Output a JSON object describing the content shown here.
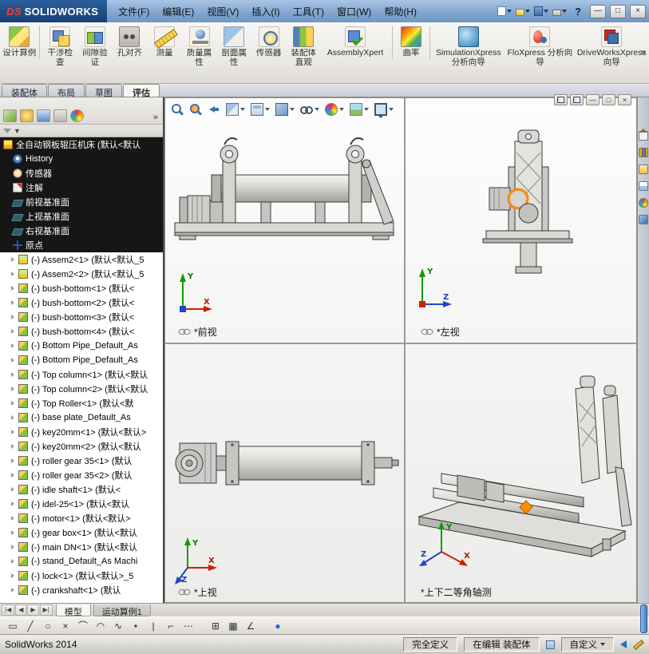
{
  "window": {
    "logo_ds": "DS",
    "logo_name": "SOLIDWORKS",
    "help_glyph": "?",
    "minimize_glyph": "—",
    "maximize_glyph": "□",
    "close_glyph": "×"
  },
  "menus": [
    {
      "label": "文件(F)"
    },
    {
      "label": "编辑(E)"
    },
    {
      "label": "视图(V)"
    },
    {
      "label": "插入(I)"
    },
    {
      "label": "工具(T)"
    },
    {
      "label": "窗口(W)"
    },
    {
      "label": "帮助(H)"
    }
  ],
  "ribbon": {
    "overflow_glyph": "»",
    "items": [
      {
        "label": "设计算例",
        "icon": "ic-study",
        "cls": "big sep-right"
      },
      {
        "label": "干涉检查",
        "icon": "ic-interference",
        "cls": ""
      },
      {
        "label": "间隙验证",
        "icon": "ic-clearance",
        "cls": ""
      },
      {
        "label": "孔对齐",
        "icon": "ic-hole",
        "cls": ""
      },
      {
        "label": "测量",
        "icon": "ic-measure",
        "cls": ""
      },
      {
        "label": "质量属性",
        "icon": "ic-mass",
        "cls": ""
      },
      {
        "label": "剖面属性",
        "icon": "ic-sectionprop",
        "cls": ""
      },
      {
        "label": "传感器",
        "icon": "ic-sensor",
        "cls": ""
      },
      {
        "label": "装配体直观",
        "icon": "ic-visualize",
        "cls": ""
      },
      {
        "label": "AssemblyXpert",
        "icon": "ic-xpert",
        "cls": "wide sep-right"
      },
      {
        "label": "曲率",
        "icon": "ic-curvature",
        "cls": "sep-right"
      },
      {
        "label": "SimulationXpress 分析向导",
        "icon": "ic-simulation",
        "cls": "wide"
      },
      {
        "label": "FloXpress 分析向导",
        "icon": "ic-floxpress",
        "cls": "wide"
      },
      {
        "label": "DriveWorksXpress 向导",
        "icon": "ic-driveworks",
        "cls": "wide"
      }
    ]
  },
  "doc_tabs": [
    {
      "label": "装配体",
      "cls": ""
    },
    {
      "label": "布局",
      "cls": ""
    },
    {
      "label": "草图",
      "cls": ""
    },
    {
      "label": "评估",
      "cls": "active"
    }
  ],
  "tree": {
    "filter_glyph": "▼",
    "more_glyph": "»",
    "items": [
      {
        "label": "全自动钢板辊压机床 (默认<默认",
        "icon": "t-assembly",
        "cls": "dark root"
      },
      {
        "label": "History",
        "icon": "t-history",
        "cls": "dark"
      },
      {
        "label": "传感器",
        "icon": "t-sensor",
        "cls": "dark"
      },
      {
        "label": "注解",
        "icon": "t-annotation",
        "cls": "dark"
      },
      {
        "label": "前视基准面",
        "icon": "t-plane",
        "cls": "dark"
      },
      {
        "label": "上视基准面",
        "icon": "t-plane",
        "cls": "dark"
      },
      {
        "label": "右视基准面",
        "icon": "t-plane",
        "cls": "dark"
      },
      {
        "label": "原点",
        "icon": "t-origin",
        "cls": "dark"
      },
      {
        "label": "(-) Assem2<1> (默认<默认_5",
        "icon": "t-subasm",
        "cls": "comp"
      },
      {
        "label": "(-) Assem2<2> (默认<默认_5",
        "icon": "t-subasm",
        "cls": "comp"
      },
      {
        "label": "(-) bush-bottom<1> (默认<",
        "icon": "t-part",
        "cls": "comp"
      },
      {
        "label": "(-) bush-bottom<2> (默认<",
        "icon": "t-part",
        "cls": "comp"
      },
      {
        "label": "(-) bush-bottom<3> (默认<",
        "icon": "t-part",
        "cls": "comp"
      },
      {
        "label": "(-) bush-bottom<4> (默认<",
        "icon": "t-part",
        "cls": "comp"
      },
      {
        "label": "(-) Bottom Pipe_Default_As",
        "icon": "t-part",
        "cls": "comp"
      },
      {
        "label": "(-) Bottom Pipe_Default_As",
        "icon": "t-part",
        "cls": "comp"
      },
      {
        "label": "(-) Top column<1> (默认<默认",
        "icon": "t-part",
        "cls": "comp"
      },
      {
        "label": "(-) Top column<2> (默认<默认",
        "icon": "t-part",
        "cls": "comp"
      },
      {
        "label": "(-) Top Roller<1> (默认<默",
        "icon": "t-part",
        "cls": "comp"
      },
      {
        "label": "(-) base plate_Default_As",
        "icon": "t-part",
        "cls": "comp"
      },
      {
        "label": "(-) key20mm<1> (默认<默认>",
        "icon": "t-part",
        "cls": "comp"
      },
      {
        "label": "(-) key20mm<2> (默认<默认",
        "icon": "t-part",
        "cls": "comp"
      },
      {
        "label": "(-) roller gear 35<1> (默认",
        "icon": "t-part",
        "cls": "comp"
      },
      {
        "label": "(-) roller gear 35<2> (默认",
        "icon": "t-part",
        "cls": "comp"
      },
      {
        "label": "(-) idle shaft<1> (默认<",
        "icon": "t-part",
        "cls": "comp"
      },
      {
        "label": "(-) idel-25<1> (默认<默认",
        "icon": "t-part",
        "cls": "comp"
      },
      {
        "label": "(-) motor<1> (默认<默认>",
        "icon": "t-part",
        "cls": "comp"
      },
      {
        "label": "(-) gear box<1> (默认<默认",
        "icon": "t-part",
        "cls": "comp"
      },
      {
        "label": "(-) main DN<1> (默认<默认",
        "icon": "t-part",
        "cls": "comp"
      },
      {
        "label": "(-) stand_Default_As Machi",
        "icon": "t-part",
        "cls": "comp"
      },
      {
        "label": "(-) lock<1> (默认<默认>_5",
        "icon": "t-part",
        "cls": "comp"
      },
      {
        "label": "(-) crankshaft<1> (默认",
        "icon": "t-part",
        "cls": "comp"
      }
    ]
  },
  "headsup": [
    {
      "name": "zoom-fit-icon",
      "kindcls": "hu-mag",
      "acls": ""
    },
    {
      "name": "zoom-area-icon",
      "kindcls": "hu-magrect",
      "acls": ""
    },
    {
      "name": "previous-view-icon",
      "kindcls": "hu-arrowback",
      "acls": ""
    },
    {
      "name": "section-view-icon",
      "kindcls": "hu-section",
      "acls": "has-arrow"
    },
    {
      "name": "view-orientation-icon",
      "kindcls": "hu-cube",
      "acls": "has-arrow"
    },
    {
      "name": "display-style-icon",
      "kindcls": "hu-shaded",
      "acls": "has-arrow"
    },
    {
      "name": "hide-show-items-icon",
      "kindcls": "hu-glasses",
      "acls": "has-arrow"
    },
    {
      "name": "edit-appearance-icon",
      "kindcls": "hu-ball",
      "acls": "has-arrow"
    },
    {
      "name": "apply-scene-icon",
      "kindcls": "hu-scene",
      "acls": "has-arrow"
    },
    {
      "name": "view-settings-icon",
      "kindcls": "hu-monitor",
      "acls": "has-arrow"
    }
  ],
  "viewports": [
    {
      "label": "*前视"
    },
    {
      "label": "*左视"
    },
    {
      "label": "*上视"
    },
    {
      "label": "*上下二等角轴测"
    }
  ],
  "axes": {
    "x": "X",
    "y": "Y",
    "z": "Z"
  },
  "model_tabs": {
    "nav": [
      {
        "glyph": "|◀"
      },
      {
        "glyph": "◀"
      },
      {
        "glyph": "▶"
      },
      {
        "glyph": "▶|"
      }
    ],
    "tabs": [
      {
        "label": "模型",
        "cls": "active"
      },
      {
        "label": "运动算例1",
        "cls": ""
      }
    ]
  },
  "sketch_tools": [
    {
      "name": "select-tool-icon",
      "glyph": "▭",
      "cls": ""
    },
    {
      "name": "line-tool-icon",
      "glyph": "╱",
      "cls": ""
    },
    {
      "name": "circle-tool-icon",
      "glyph": "○",
      "cls": ""
    },
    {
      "name": "trim-tool-icon",
      "glyph": "×",
      "cls": ""
    },
    {
      "name": "arc-tool-icon",
      "glyph": "⌒",
      "cls": ""
    },
    {
      "name": "tangent-arc-tool-icon",
      "glyph": "◠",
      "cls": ""
    },
    {
      "name": "spline-tool-icon",
      "glyph": "∿",
      "cls": ""
    },
    {
      "name": "point-tool-icon",
      "glyph": "•",
      "cls": ""
    },
    {
      "name": "centerline-tool-icon",
      "glyph": "|",
      "cls": ""
    },
    {
      "name": "corner-rectangle-tool-icon",
      "glyph": "⌐",
      "cls": ""
    },
    {
      "name": "polygon-tool-icon",
      "glyph": "⋯",
      "cls": ""
    },
    {
      "name": "linear-pattern-tool-icon",
      "glyph": "⊞",
      "cls": "gap"
    },
    {
      "name": "grid-pattern-tool-icon",
      "glyph": "▦",
      "cls": ""
    },
    {
      "name": "smart-dimension-tool-icon",
      "glyph": "∠",
      "cls": ""
    },
    {
      "name": "snap-tool-icon",
      "glyph": "●",
      "cls": "gap blue"
    }
  ],
  "statusbar": {
    "app": "SolidWorks 2014",
    "define_state": "完全定义",
    "edit_state": "在编辑 装配体",
    "custom": "自定义"
  }
}
